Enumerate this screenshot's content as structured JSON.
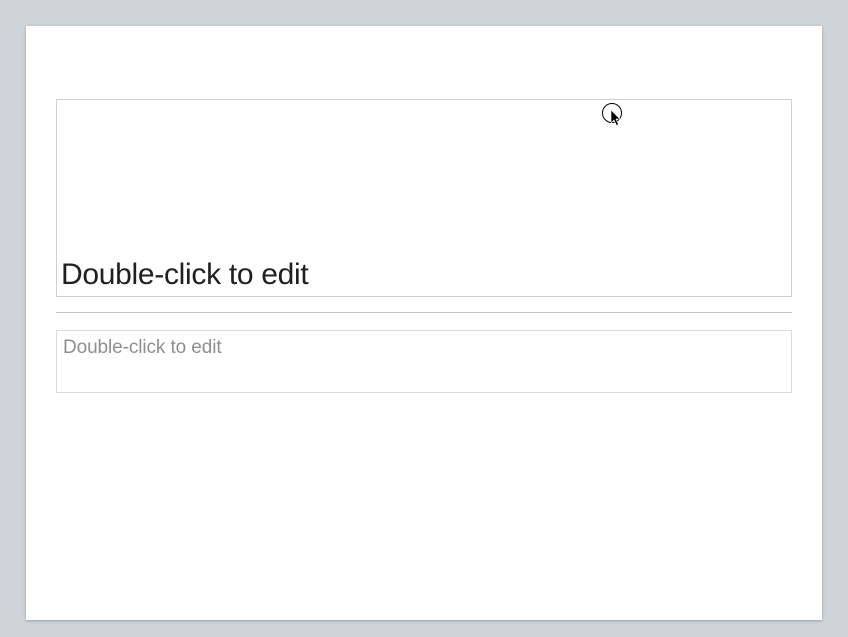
{
  "slide": {
    "title_placeholder": "Double-click to edit",
    "body_placeholder": "Double-click to edit"
  }
}
